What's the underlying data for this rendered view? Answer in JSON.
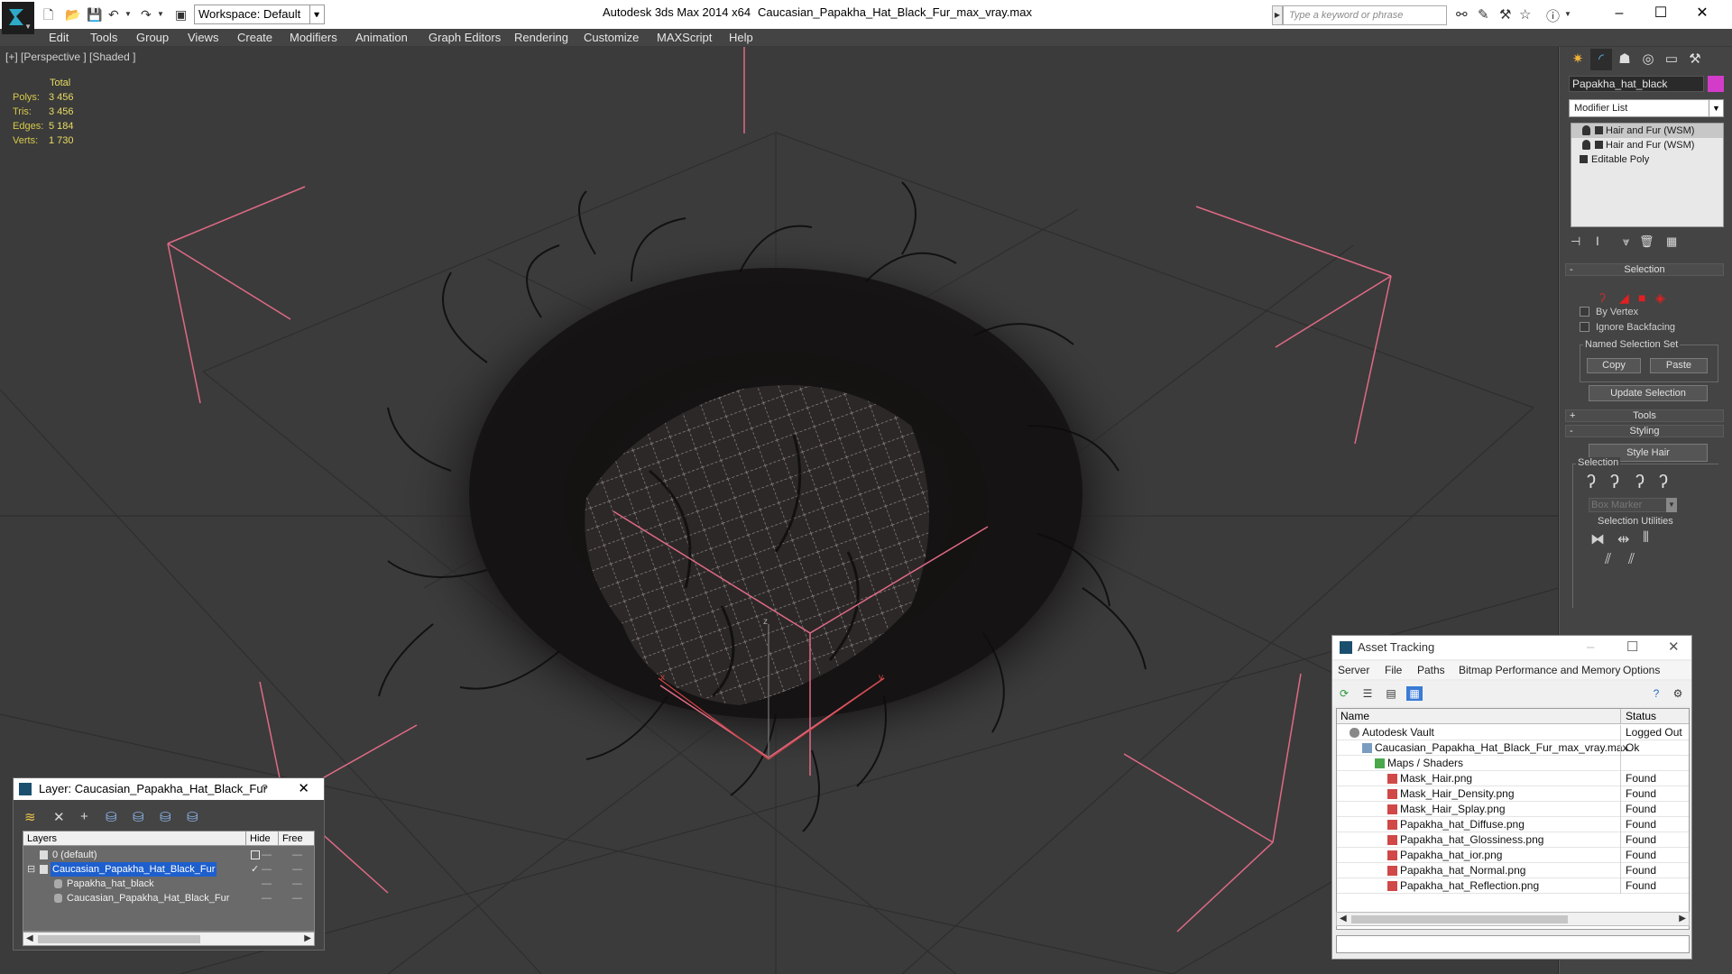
{
  "titlebar": {
    "app_title": "Autodesk 3ds Max  2014 x64",
    "file_title": "Caucasian_Papakha_Hat_Black_Fur_max_vray.max",
    "workspace_value": "Workspace: Default",
    "search_placeholder": "Type a keyword or phrase"
  },
  "menu": {
    "items": [
      "Edit",
      "Tools",
      "Group",
      "Views",
      "Create",
      "Modifiers",
      "Animation",
      "Graph Editors",
      "Rendering",
      "Customize",
      "MAXScript",
      "Help"
    ]
  },
  "viewport": {
    "label": "[+] [Perspective ] [Shaded ]",
    "stats": {
      "header": "Total",
      "rows": [
        {
          "label": "Polys:",
          "value": "3 456"
        },
        {
          "label": "Tris:",
          "value": "3 456"
        },
        {
          "label": "Edges:",
          "value": "5 184"
        },
        {
          "label": "Verts:",
          "value": "1 730"
        }
      ]
    },
    "axes": {
      "x": "x",
      "y": "y",
      "z": "z"
    }
  },
  "command_panel": {
    "object_name": "Papakha_hat_black",
    "object_color": "#d23cc8",
    "modifier_list": "Modifier List",
    "stack": [
      "Hair and Fur (WSM)",
      "Hair and Fur (WSM)",
      "Editable Poly"
    ],
    "selection": {
      "title": "Selection",
      "by_vertex": "By Vertex",
      "ignore_backfacing": "Ignore Backfacing",
      "named_set": "Named Selection Set",
      "copy": "Copy",
      "paste": "Paste",
      "update": "Update Selection"
    },
    "tools_title": "Tools",
    "styling": {
      "title": "Styling",
      "style_hair": "Style Hair",
      "selection": "Selection",
      "box_marker": "Box Marker",
      "utilities": "Selection Utilities"
    }
  },
  "layer_dialog": {
    "title": "Layer: Caucasian_Papakha_Hat_Black_Fur",
    "help": "?",
    "columns": {
      "layers": "Layers",
      "hide": "Hide",
      "freeze": "Free"
    },
    "rows": [
      {
        "name": "0 (default)"
      },
      {
        "name": "Caucasian_Papakha_Hat_Black_Fur"
      },
      {
        "name": "Papakha_hat_black"
      },
      {
        "name": "Caucasian_Papakha_Hat_Black_Fur"
      }
    ]
  },
  "asset_tracking": {
    "title": "Asset Tracking",
    "menu": [
      "Server",
      "File",
      "Paths",
      "Bitmap Performance and Memory",
      "Options"
    ],
    "columns": {
      "name": "Name",
      "status": "Status"
    },
    "rows": [
      {
        "name": "Autodesk Vault",
        "status": "Logged Out"
      },
      {
        "name": "Caucasian_Papakha_Hat_Black_Fur_max_vray.max",
        "status": "Ok"
      },
      {
        "name": "Maps / Shaders",
        "status": ""
      },
      {
        "name": "Mask_Hair.png",
        "status": "Found"
      },
      {
        "name": "Mask_Hair_Density.png",
        "status": "Found"
      },
      {
        "name": "Mask_Hair_Splay.png",
        "status": "Found"
      },
      {
        "name": "Papakha_hat_Diffuse.png",
        "status": "Found"
      },
      {
        "name": "Papakha_hat_Glossiness.png",
        "status": "Found"
      },
      {
        "name": "Papakha_hat_ior.png",
        "status": "Found"
      },
      {
        "name": "Papakha_hat_Normal.png",
        "status": "Found"
      },
      {
        "name": "Papakha_hat_Reflection.png",
        "status": "Found"
      }
    ]
  },
  "colors": {
    "stats_text": "#e9dc63",
    "bounding_box": "#e06a86",
    "selection_highlight": "#1e5fce"
  }
}
